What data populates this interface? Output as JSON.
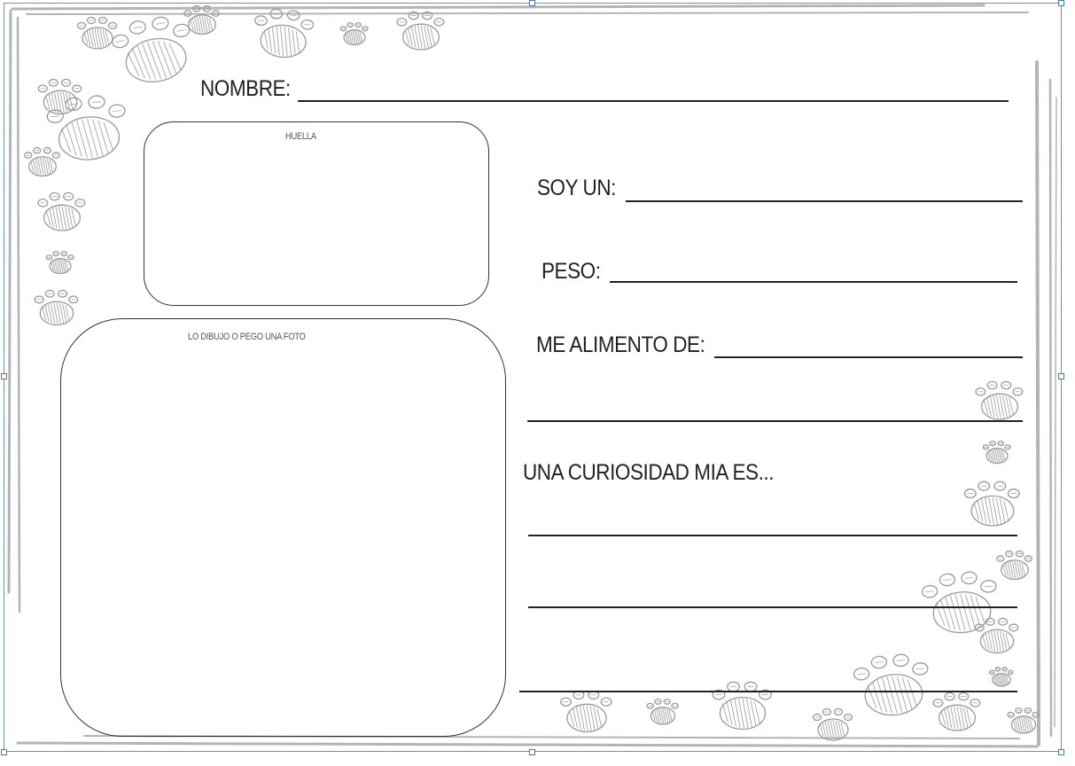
{
  "worksheet": {
    "name_label": "NOMBRE:",
    "fingerprint_box_label": "HUELLA",
    "photo_box_label": "LO DIBUJO O PEGO UNA FOTO",
    "soy_label": "SOY UN:",
    "peso_label": "PESO:",
    "alimento_label": "ME ALIMENTO DE:",
    "curiosidad_label": "UNA CURIOSIDAD MIA ES..."
  },
  "colors": {
    "border_gray": "#b4b4b4",
    "paw_gray": "#9a9a9a",
    "selection_blue": "#6f8fb6",
    "ink": "#222222"
  },
  "icons": {
    "decoration": "paw-print-icon"
  }
}
